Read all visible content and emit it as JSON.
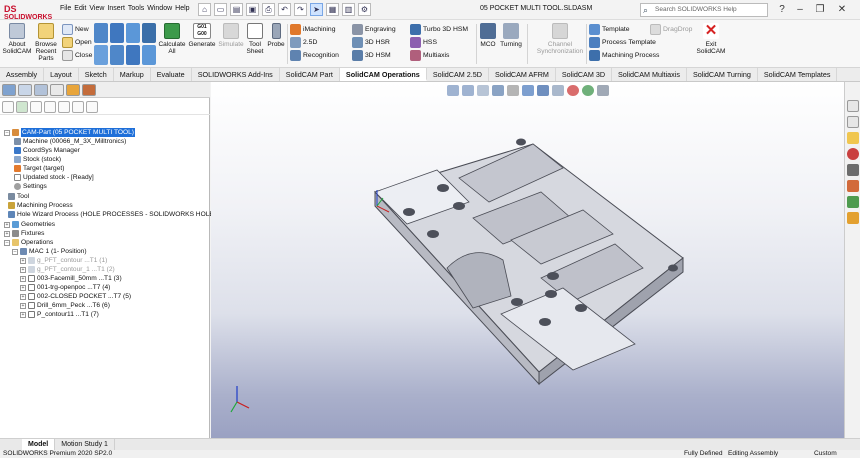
{
  "app": {
    "logo": "SOLIDWORKS",
    "menu": [
      "File",
      "Edit",
      "View",
      "Insert",
      "Tools",
      "Window",
      "Help"
    ],
    "document_title": "05 POCKET MULTI TOOL.SLDASM",
    "search_placeholder": "Search SOLIDWORKS Help"
  },
  "ribbon": {
    "about": "About SolidCAM",
    "browse": "Browse Recent Parts",
    "new": "New",
    "open": "Open",
    "close": "Close",
    "calculate": "Calculate All",
    "gcode_icon": "G01 G00",
    "generate": "Generate",
    "simulate": "Simulate",
    "tool_sheet": "Tool Sheet",
    "probe": "Probe",
    "imachining": "iMachining",
    "d25": "2.5D",
    "recognition": "Recognition",
    "engraving": "Engraving",
    "hsr": "3D HSR",
    "hsm": "3D HSM",
    "turbo": "Turbo 3D HSM",
    "hss": "HSS",
    "multiaxis": "Multiaxis",
    "mco": "MCO",
    "turning": "Turning",
    "channel_sync": "Channel Synchronization",
    "template": "Template",
    "process_template": "Process Template",
    "machining_process": "Machining Process",
    "dragdrop": "DragDrop",
    "exit": "Exit SolidCAM"
  },
  "tabs": [
    "Assembly",
    "Layout",
    "Sketch",
    "Markup",
    "Evaluate",
    "SOLIDWORKS Add-Ins",
    "SolidCAM Part",
    "SolidCAM Operations",
    "SolidCAM 2.5D",
    "SolidCAM AFRM",
    "SolidCAM 3D",
    "SolidCAM Multiaxis",
    "SolidCAM Turning",
    "SolidCAM Templates"
  ],
  "active_tab": "SolidCAM Operations",
  "tree": {
    "root": "CAM-Part (05 POCKET MULTI TOOL)",
    "machine": "Machine (00066_M_3X_Milltronics)",
    "coordsys": "CoordSys Manager",
    "stock": "Stock (stock)",
    "target": "Target (target)",
    "updated_stock": "Updated stock - [Ready]",
    "settings": "Settings",
    "tool": "Tool",
    "machining_process": "Machining Process",
    "hole_wizard": "Hole Wizard Process (HOLE PROCESSES - SOLIDWORKS HOLE WI",
    "geometries": "Geometries",
    "fixtures": "Fixtures",
    "operations": "Operations",
    "mac1": "MAC 1 (1- Position)",
    "ops": [
      {
        "label": "g_PFT_contour ...T1 (1)",
        "disabled": true
      },
      {
        "label": "g_PFT_contour_1 ...T1 (2)",
        "disabled": true
      },
      {
        "label": "003-Facemill_50mm ...T1 (3)",
        "disabled": false
      },
      {
        "label": "001-trg-openpoc ...T7 (4)",
        "disabled": false
      },
      {
        "label": "002-CLOSED POCKET ...T7 (5)",
        "disabled": false
      },
      {
        "label": "Drill_6mm_Peck ...T6 (6)",
        "disabled": false
      },
      {
        "label": "P_contour11 ...T1 (7)",
        "disabled": false
      }
    ]
  },
  "bottom": {
    "tabs": [
      "Model",
      "Motion Study 1"
    ],
    "status_left": "SOLIDWORKS Premium 2020 SP2.0",
    "status_defined": "Fully Defined",
    "status_mode": "Editing Assembly",
    "status_units": "Custom"
  },
  "colors": {
    "accent": "#1e6fd9",
    "exit_red": "#d62222",
    "logo_red": "#c8102e",
    "part_gray": "#c9cbd3"
  }
}
